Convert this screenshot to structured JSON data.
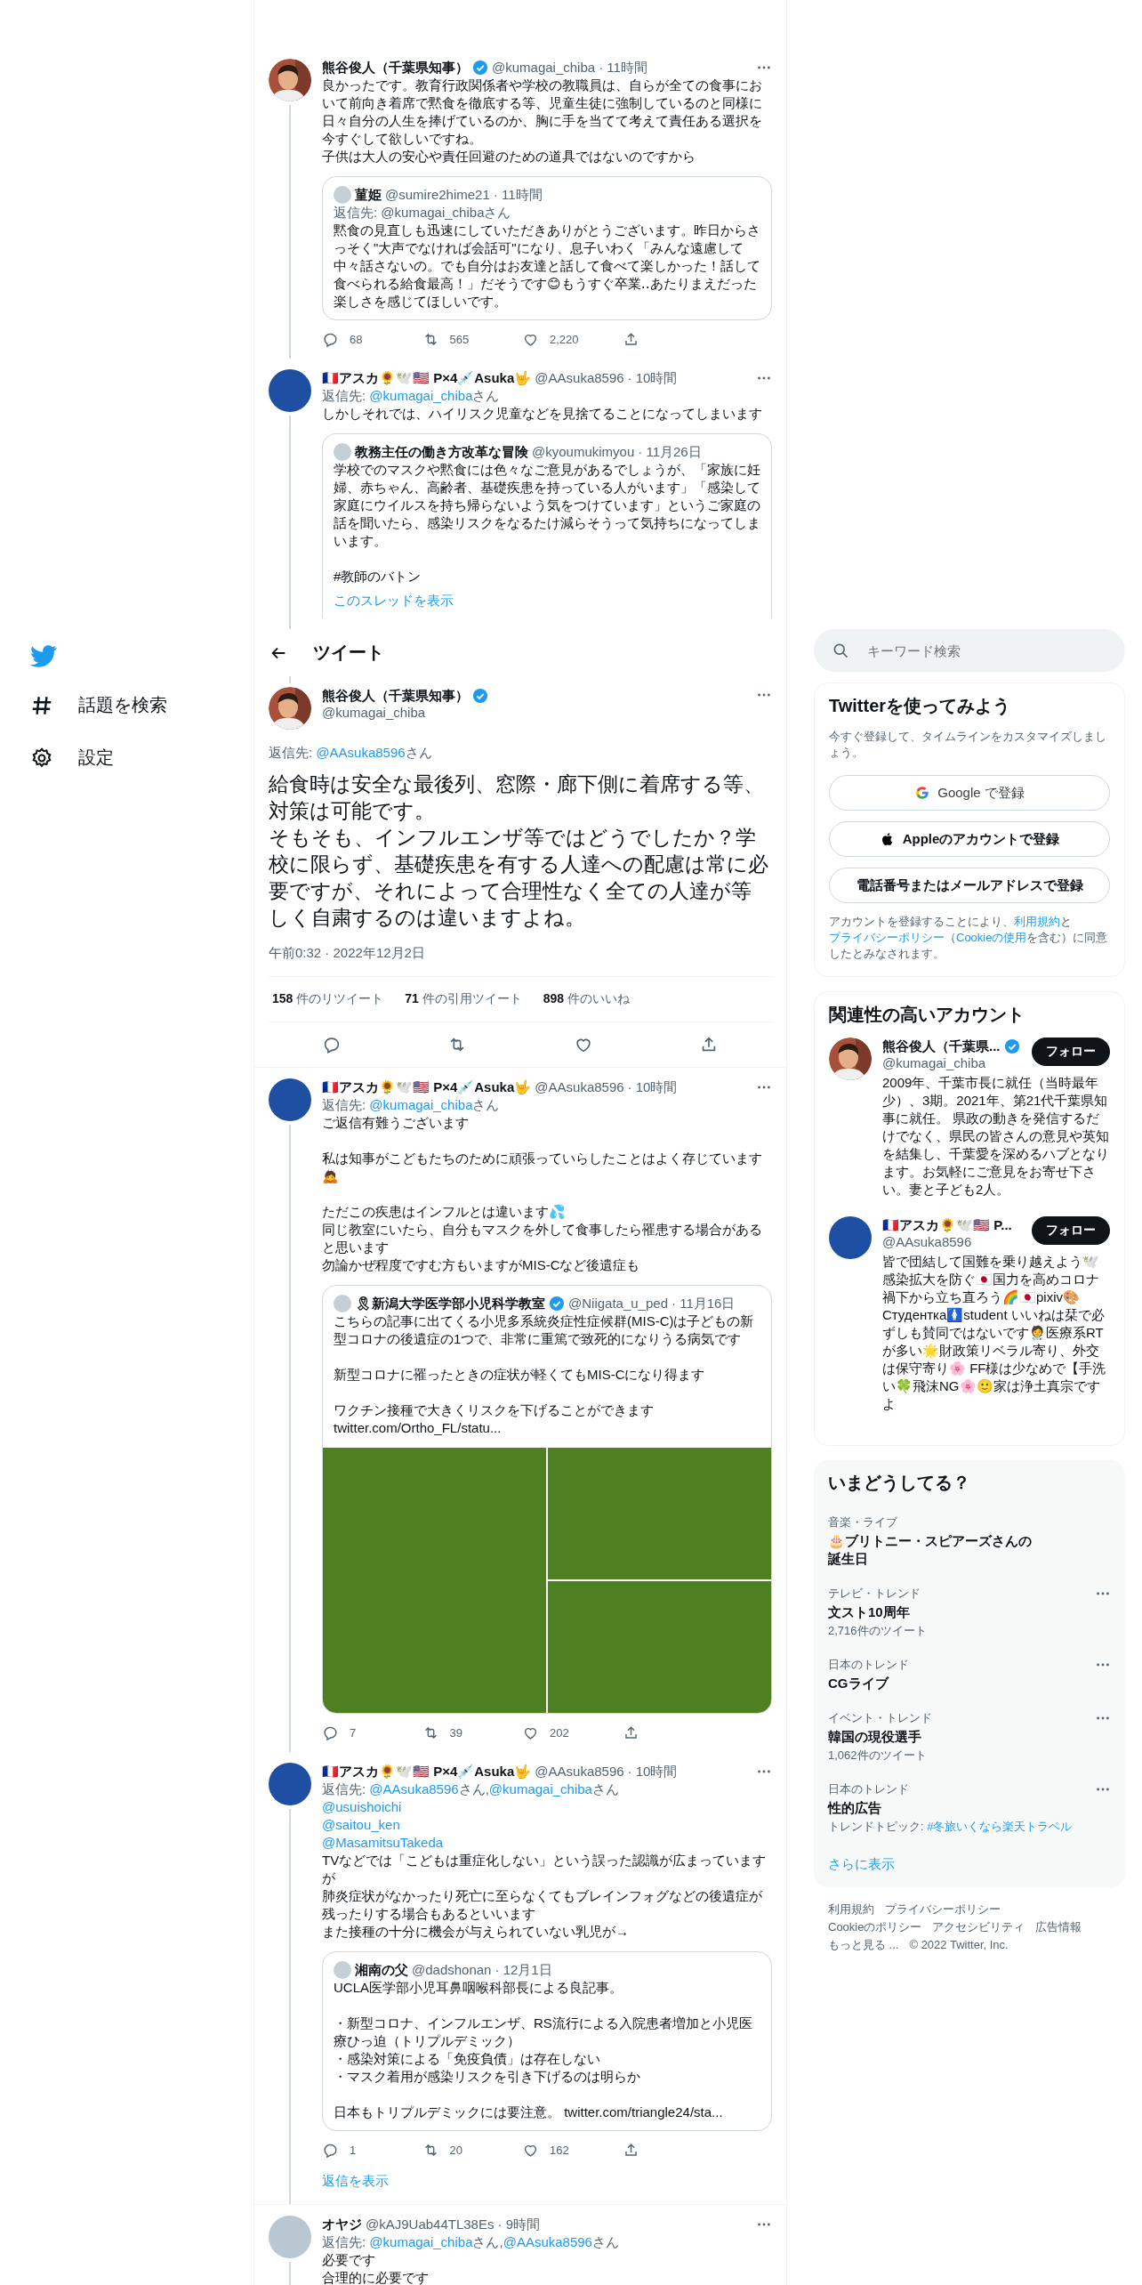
{
  "nav": {
    "items": [
      {
        "kind": "explore",
        "label": "話題を検索"
      },
      {
        "kind": "settings",
        "label": "設定"
      }
    ]
  },
  "header": {
    "title": "ツイート"
  },
  "thread_above": [
    {
      "avatar": {
        "kind": "picture"
      },
      "name": "熊谷俊人（千葉県知事）",
      "verified": true,
      "handle": "@kumagai_chiba",
      "time": "· 11時間",
      "line_below": true,
      "body": [
        [
          [
            {
              "t": "良かったです。教育行政関係者や学校の教職員は、自らが全ての食事において前向き着席で黙食を徹底する等、児童生徒に強制しているのと同様に日々自分の人生を捧げているのか、胸に手を当てて考えて責任ある選択を今すぐして欲しいですね。"
            }
          ],
          [
            {
              "t": "子供は大人の安心や責任回避のための道具ではないのですから"
            }
          ]
        ]
      ],
      "quote": {
        "name": "菫姫",
        "handle": "@sumire2hime21",
        "time": "· 11時間",
        "reply_to": {
          "label": "返信先:",
          "mentions": [
            {
              "handle": "@kumagai_chiba",
              "after": "さん"
            }
          ]
        },
        "body": [
          [
            [
              {
                "t": "黙食の見直しも迅速にしていただきありがとうございます。昨日からさっそく\"大声でなければ会話可\"になり、息子いわく「みんな遠慮して中々話さないの。でも自分はお友達と話して食べて楽しかった！話して食べられる給食最高！」だそうです😊もうすぐ卒業‥あたりまえだった楽しさを感じてほしいです。"
              }
            ]
          ]
        ]
      },
      "counts": {
        "reply": "68",
        "retweet": "565",
        "like": "2,220"
      }
    },
    {
      "avatar": {
        "kind": "plain",
        "color": "#1f4fa3"
      },
      "name": "🇫🇷アスカ🌻🕊️🇺🇸 P×4💉Asuka🤟",
      "handle": "@AAsuka8596",
      "time": "· 10時間",
      "line_below": true,
      "reply_to": {
        "label": "返信先:",
        "mentions": [
          {
            "handle": "@kumagai_chiba",
            "after": "さん"
          }
        ]
      },
      "body": [
        [
          [
            {
              "t": "しかしそれでは、ハイリスク児童などを見捨てることになってしまいます"
            }
          ]
        ]
      ],
      "quote": {
        "truncated": true,
        "name": "教務主任の働き方改革な冒険",
        "handle": "@kyoumukimyou",
        "time": "· 11月26日",
        "body": [
          [
            [
              {
                "t": "学校でのマスクや黙食には色々なご意見があるでしょうが、「家族に妊婦、赤ちゃん、高齢者、基礎疾患を持っている人がいます」「感染して家庭にウイルスを持ち帰らないよう気をつけています」というご家庭の話を聞いたら、感染リスクをなるたけ減らそうって気持ちになってしまいます。"
              }
            ]
          ],
          [
            [
              {
                "t": " #教師のバトン"
              }
            ]
          ]
        ],
        "link": "このスレッドを表示"
      }
    }
  ],
  "main": {
    "avatar": {
      "kind": "picture"
    },
    "name": "熊谷俊人（千葉県知事）",
    "verified": true,
    "handle": "@kumagai_chiba",
    "reply_to": {
      "label": "返信先:",
      "mentions": [
        {
          "handle": "@AAsuka8596",
          "after": "さん"
        }
      ]
    },
    "body": [
      [
        [
          {
            "t": "給食時は安全な最後列、窓際・廊下側に着席する等、対策は可能です。"
          }
        ],
        [
          {
            "t": "そもそも、インフルエンザ等ではどうでしたか？学校に限らず、基礎疾患を有する人達への配慮は常に必要ですが、それによって合理性なく全ての人達が等しく自粛するのは違いますよね。"
          }
        ]
      ]
    ],
    "timestamp": "午前0:32 · 2022年12月2日",
    "stats": [
      {
        "count": "158",
        "label": "件のリツイート"
      },
      {
        "count": "71",
        "label": "件の引用ツイート"
      },
      {
        "count": "898",
        "label": "件のいいね"
      }
    ]
  },
  "replies": [
    {
      "avatar": {
        "kind": "plain",
        "color": "#1f4fa3"
      },
      "name": "🇫🇷アスカ🌻🕊️🇺🇸 P×4💉Asuka🤟",
      "handle": "@AAsuka8596",
      "time": "· 10時間",
      "line_below": true,
      "reply_to": {
        "label": "返信先:",
        "mentions": [
          {
            "handle": "@kumagai_chiba",
            "after": "さん"
          }
        ]
      },
      "body": [
        [
          [
            {
              "t": "ご返信有難うございます"
            }
          ]
        ],
        [
          [
            {
              "t": "私は知事がこどもたちのために頑張っていらしたことはよく存じています🙇"
            }
          ]
        ],
        [
          [
            {
              "t": "ただこの疾患はインフルとは違います💦"
            }
          ],
          [
            {
              "t": "同じ教室にいたら、自分もマスクを外して食事したら罹患する場合があると思います"
            }
          ],
          [
            {
              "t": "勿論かぜ程度ですむ方もいますがMIS-Cなど後遺症も"
            }
          ]
        ]
      ],
      "quote": {
        "name": "🎗新潟大学医学部小児科学教室",
        "verified": true,
        "handle": "@Niigata_u_ped",
        "time": "· 11月16日",
        "body": [
          [
            [
              {
                "t": "こちらの記事に出てくる小児多系統炎症性症候群(MIS-C)は子どもの新型コロナの後遺症の1つで、非常に重篤で致死的になりうる病気です"
              }
            ]
          ],
          [
            [
              {
                "t": "新型コロナに罹ったときの症状が軽くてもMIS-Cになり得ます"
              }
            ]
          ],
          [
            [
              {
                "t": "ワクチン接種で大きくリスクを下げることができます"
              }
            ],
            [
              {
                "t": "twitter.com/Ortho_FL/statu..."
              }
            ]
          ]
        ],
        "media": [
          {
            "kind": "picture"
          },
          {
            "kind": "picture"
          },
          {
            "kind": "picture"
          }
        ]
      },
      "counts": {
        "reply": "7",
        "retweet": "39",
        "like": "202"
      }
    },
    {
      "avatar": {
        "kind": "plain",
        "color": "#1f4fa3"
      },
      "name": "🇫🇷アスカ🌻🕊️🇺🇸 P×4💉Asuka🤟",
      "handle": "@AAsuka8596",
      "time": "· 10時間",
      "line_below": true,
      "reply_to": {
        "label": "返信先:",
        "mentions": [
          {
            "handle": "@AAsuka8596",
            "after": "さん,"
          },
          {
            "handle": "@kumagai_chiba",
            "after": "さん"
          }
        ]
      },
      "body": [
        [
          [
            {
              "m": "@usuishoichi"
            }
          ],
          [
            {
              "m": "@saitou_ken"
            }
          ],
          [
            {
              "m": "@MasamitsuTakeda"
            }
          ],
          [
            {
              "t": "TVなどでは「こどもは重症化しない」という誤った認識が広まっていますが"
            }
          ],
          [
            {
              "t": "肺炎症状がなかったり死亡に至らなくてもブレインフォグなどの後遺症が残ったりする場合もあるといいます"
            }
          ],
          [
            {
              "t": "また接種の十分に機会が与えられていない乳児が→"
            }
          ]
        ]
      ],
      "quote": {
        "name": "湘南の父",
        "handle": "@dadshonan",
        "time": "· 12月1日",
        "body": [
          [
            [
              {
                "t": "UCLA医学部小児耳鼻咽喉科部長による良記事。"
              }
            ]
          ],
          [
            [
              {
                "t": "・新型コロナ、インフルエンザ、RS流行による入院患者増加と小児医療ひっ迫（トリプルデミック）"
              }
            ],
            [
              {
                "t": "・感染対策による「免疫負債」は存在しない"
              }
            ],
            [
              {
                "t": "・マスク着用が感染リスクを引き下げるのは明らか"
              }
            ]
          ],
          [
            [
              {
                "t": "日本もトリプルデミックには要注意。 twitter.com/triangle24/sta..."
              }
            ]
          ]
        ]
      },
      "counts": {
        "reply": "1",
        "retweet": "20",
        "like": "162"
      },
      "show_replies": "返信を表示"
    },
    {
      "avatar": {
        "kind": "plain",
        "color": "#b8c7d1"
      },
      "name": "オヤジ",
      "handle": "@kAJ9Uab44TL38Es",
      "time": "· 9時間",
      "line_below": true,
      "reply_to": {
        "label": "返信先:",
        "mentions": [
          {
            "handle": "@kumagai_chiba",
            "after": "さん,"
          },
          {
            "handle": "@AAsuka8596",
            "after": "さん"
          }
        ]
      },
      "body": [
        [
          [
            {
              "t": "必要です"
            }
          ],
          [
            {
              "t": "合理的に必要です"
            }
          ]
        ]
      ]
    }
  ],
  "sidebar": {
    "search": {
      "placeholder": "キーワード検索"
    },
    "signup": {
      "title": "Twitterを使ってみよう",
      "text": "今すぐ登録して、タイムラインをカスタマイズしましょう。",
      "buttons": [
        {
          "kind": "google",
          "label": "Google で登録"
        },
        {
          "kind": "apple",
          "label": "Appleのアカウントで登録"
        },
        {
          "kind": "plain",
          "label": "電話番号またはメールアドレスで登録"
        }
      ],
      "legal": [
        {
          "t": "アカウントを登録することにより、"
        },
        {
          "l": "利用規約"
        },
        {
          "t": "と"
        },
        {
          "l": "プライバシーポリシー"
        },
        {
          "t": "（"
        },
        {
          "l": "Cookieの使用"
        },
        {
          "t": "を含む）に同意したとみなされます。"
        }
      ]
    },
    "related": {
      "title": "関連性の高いアカウント",
      "accounts": [
        {
          "avatar": {
            "kind": "picture"
          },
          "name": "熊谷俊人（千葉県...",
          "verified": true,
          "handle": "@kumagai_chiba",
          "follow": "フォロー",
          "bio": "2009年、千葉市長に就任（当時最年少）、3期。2021年、第21代千葉県知事に就任。 県政の動きを発信するだけでなく、県民の皆さんの意見や英知を結集し、千葉愛を深めるハブとなります。お気軽にご意見をお寄せ下さい。妻と子ども2人。"
        },
        {
          "avatar": {
            "kind": "plain",
            "color": "#1f4fa3"
          },
          "name": "🇫🇷アスカ🌻🕊️🇺🇸 P...",
          "handle": "@AAsuka8596",
          "follow": "フォロー",
          "bio": "皆で団結して国難を乗り越えよう🕊️感染拡大を防ぐ🇯🇵国力を高めコロナ禍下から立ち直ろう🌈🇯🇵pixiv🎨Студентка🚺student いいねは栞で必ずしも賛同ではないです🧑‍⚕️医療系RTが多い🌟財政策リベラル寄り、外交は保守寄り🌸 FF様は少なめで【手洗い🍀飛沫NG🌸🙂家は浄土真宗ですよ"
        }
      ]
    },
    "trends": {
      "title": "いまどうしてる？",
      "items": [
        {
          "category": "音楽・ライブ",
          "title": "🎂ブリトニー・スピアーズさんの誕生日"
        },
        {
          "category": "テレビ・トレンド",
          "title": "文スト10周年",
          "count": "2,716件のツイート",
          "more": true
        },
        {
          "category": "日本のトレンド",
          "title": "CGライブ",
          "more": true
        },
        {
          "category": "イベント・トレンド",
          "title": "韓国の現役選手",
          "count": "1,062件のツイート",
          "more": true
        },
        {
          "category": "日本のトレンド",
          "title": "性的広告",
          "topic": {
            "label": "トレンドトピック:",
            "tag": "#冬旅いくなら楽天トラベル"
          },
          "more": true
        }
      ],
      "show_more": "さらに表示"
    },
    "footer": {
      "links": [
        "利用規約",
        "プライバシーポリシー",
        "Cookieのポリシー",
        "アクセシビリティ",
        "広告情報",
        "もっと見る ..."
      ],
      "copyright": "© 2022 Twitter, Inc."
    }
  }
}
